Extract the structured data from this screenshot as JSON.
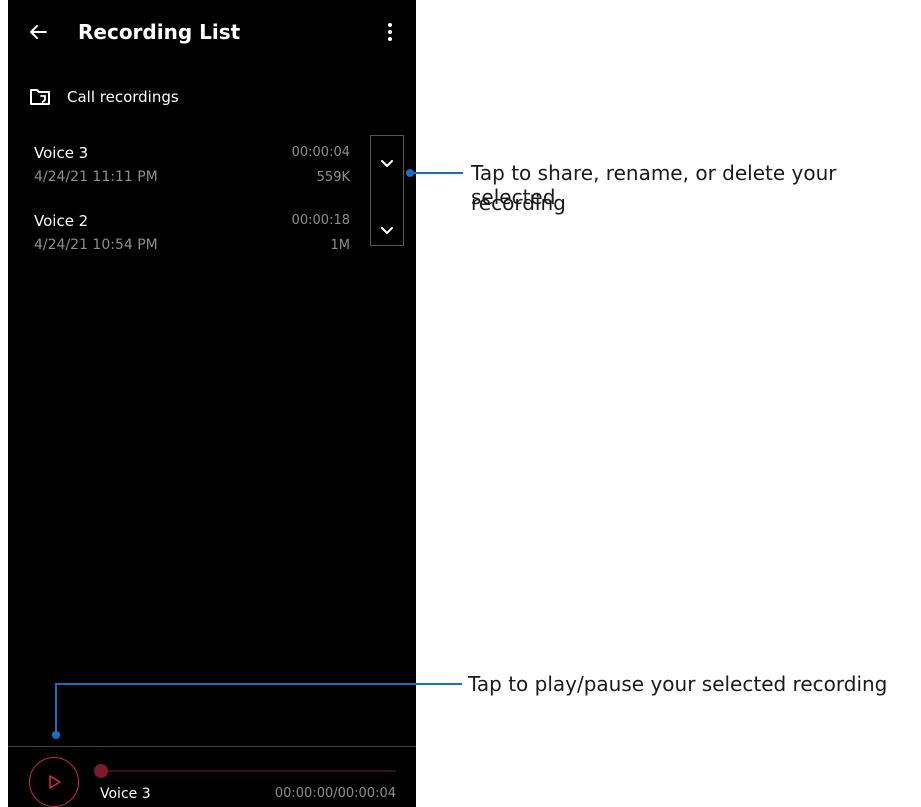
{
  "header": {
    "title": "Recording List",
    "back_icon": "arrow-left-icon",
    "menu_icon": "more-vertical-icon"
  },
  "folder": {
    "icon": "folder-sync-icon",
    "label": "Call recordings"
  },
  "recordings": [
    {
      "name": "Voice 3",
      "date": "4/24/21 11:11 PM",
      "duration": "00:00:04",
      "size": "559K"
    },
    {
      "name": "Voice 2",
      "date": "4/24/21 10:54 PM",
      "duration": "00:00:18",
      "size": "1M"
    }
  ],
  "player": {
    "name": "Voice 3",
    "time": "00:00:00/00:00:04",
    "progress": 0,
    "play_icon": "play-icon"
  },
  "callouts": {
    "expand": {
      "line1": "Tap to share, rename, or delete your selected",
      "line2": "recording"
    },
    "play": {
      "text": "Tap to play/pause your selected recording"
    }
  },
  "colors": {
    "accent": "#d2264a",
    "callout_line": "#1570c3",
    "background": "#000000"
  }
}
